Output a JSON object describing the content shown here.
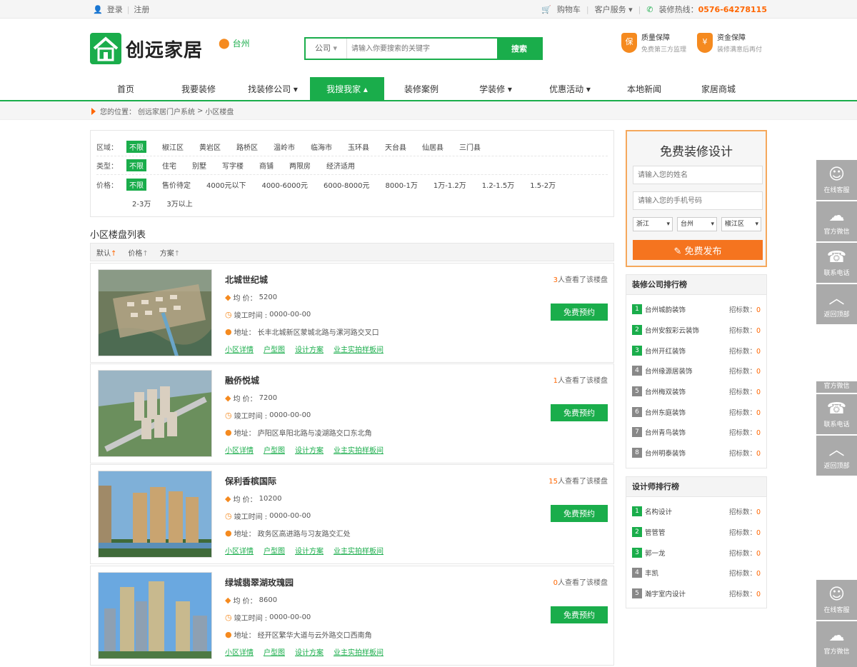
{
  "topbar": {
    "login": "登录",
    "register": "注册",
    "cart": "购物车",
    "service": "客户服务",
    "hotline_label": "装修热线：",
    "hotline": "0576-64278115"
  },
  "header": {
    "logo_text": "创远家居",
    "city": "台州",
    "search_type": "公司",
    "search_placeholder": "请输入你要搜索的关键字",
    "search_button": "搜索",
    "g1_title": "质量保障",
    "g1_sub": "免费第三方监理",
    "g2_title": "资金保障",
    "g2_sub": "装修满意后再付"
  },
  "nav": [
    "首页",
    "我要装修",
    "找装修公司",
    "我搜我家",
    "装修案例",
    "学装修",
    "优惠活动",
    "本地新闻",
    "家居商城"
  ],
  "breadcrumb": {
    "label": "您的位置：",
    "site": "创远家居门户系统",
    "sep": ">",
    "current": "小区楼盘"
  },
  "filter": {
    "area_label": "区域：",
    "areas": [
      "不限",
      "椒江区",
      "黄岩区",
      "路桥区",
      "温岭市",
      "临海市",
      "玉环县",
      "天台县",
      "仙居县",
      "三门县"
    ],
    "type_label": "类型：",
    "types": [
      "不限",
      "住宅",
      "别墅",
      "写字楼",
      "商铺",
      "两限房",
      "经济适用"
    ],
    "price_label": "价格：",
    "prices": [
      "不限",
      "售价待定",
      "4000元以下",
      "4000-6000元",
      "6000-8000元",
      "8000-1万",
      "1万-1.2万",
      "1.2-1.5万",
      "1.5-2万"
    ],
    "prices2": [
      "2-3万",
      "3万以上"
    ]
  },
  "list": {
    "title": "小区楼盘列表",
    "sort": [
      "默认",
      "价格",
      "方案"
    ],
    "price_prefix": "均 价：",
    "time_prefix": "竣工时间 :",
    "addr_prefix": "地址：",
    "view_suffix": "人查看了该楼盘",
    "book": "免费预约",
    "links": [
      "小区详情",
      "户型图",
      "设计方案",
      "业主实拍样板间"
    ],
    "items": [
      {
        "name": "北城世纪城",
        "views": "3",
        "price": "5200",
        "time": "0000-00-00",
        "addr": "长丰北城新区蒙城北路与漯河路交叉口"
      },
      {
        "name": "融侨悦城",
        "views": "1",
        "price": "7200",
        "time": "0000-00-00",
        "addr": "庐阳区阜阳北路与凌湖路交口东北角"
      },
      {
        "name": "保利香槟国际",
        "views": "15",
        "price": "10200",
        "time": "0000-00-00",
        "addr": "政务区高进路与习友路交汇处"
      },
      {
        "name": "绿城翡翠湖玫瑰园",
        "views": "0",
        "price": "8600",
        "time": "0000-00-00",
        "addr": "经开区繁华大道与云外路交口西南角"
      }
    ]
  },
  "sidebar": {
    "form_title": "免费装修设计",
    "name_placeholder": "请输入您的姓名",
    "phone_placeholder": "请输入您的手机号码",
    "province": "浙江",
    "city": "台州",
    "district": "椒江区",
    "publish": "免费发布",
    "rank1_title": "装修公司排行榜",
    "rank2_title": "设计师排行榜",
    "score_label": "招标数：",
    "companies": [
      "台州城韵装饰",
      "台州安叙彩云装饰",
      "台州开红装饰",
      "台州缘源居装饰",
      "台州梅双装饰",
      "台州东庭装饰",
      "台州青鸟装饰",
      "台州明泰装饰"
    ],
    "designers": [
      "名构设计",
      "管管管",
      "郭一龙",
      "丰凯",
      "瀚宇室内设计"
    ],
    "score": "0"
  },
  "tools": {
    "online": "在线客服",
    "wechat": "官方微信",
    "phone": "联系电话",
    "top": "返回顶部"
  }
}
